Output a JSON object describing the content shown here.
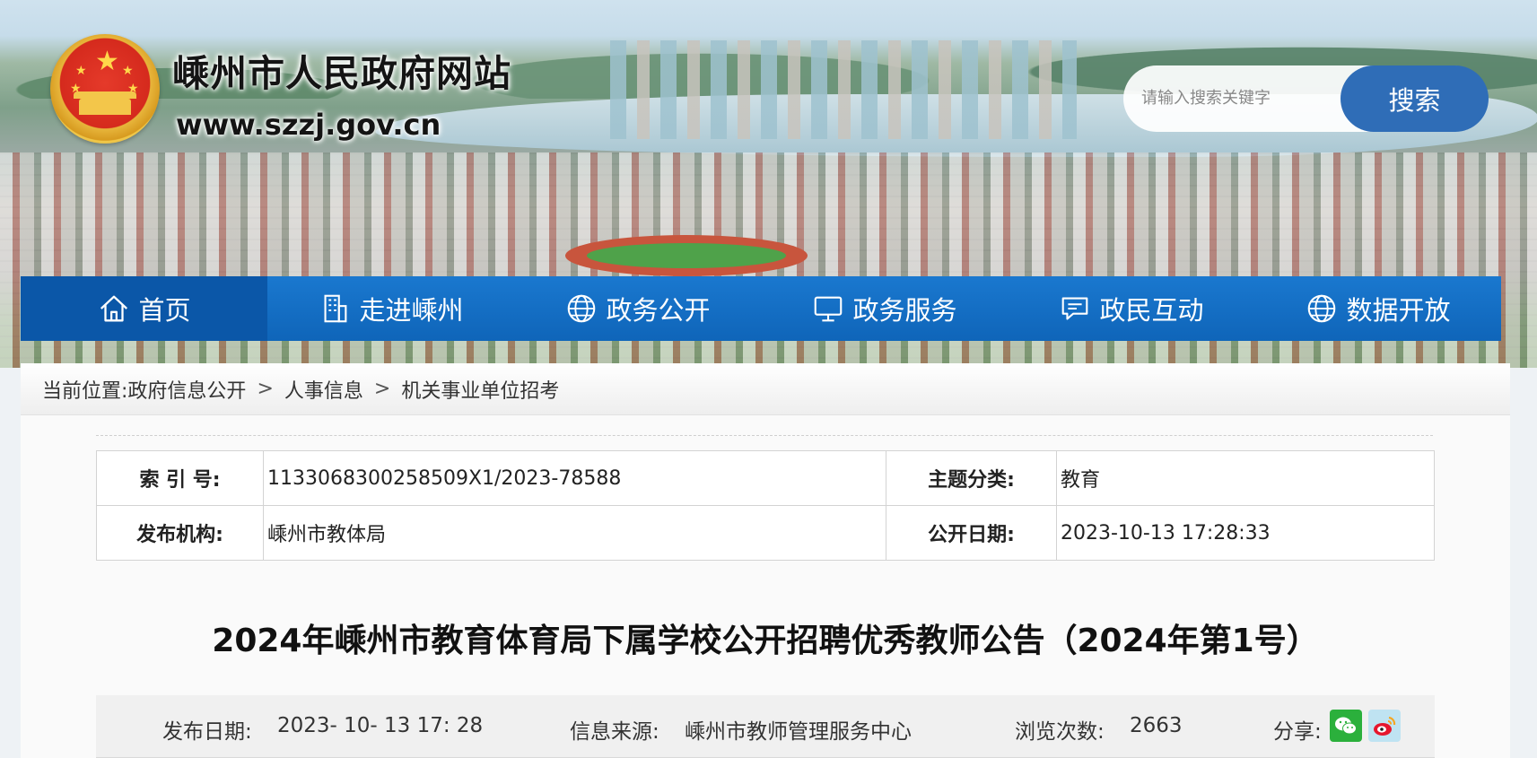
{
  "header": {
    "site_title": "嵊州市人民政府网站",
    "site_url": "www.szzj.gov.cn",
    "emblem_icon": "national-emblem-icon"
  },
  "search": {
    "placeholder": "请输入搜索关键字",
    "button_label": "搜索"
  },
  "nav": {
    "items": [
      {
        "label": "首页",
        "icon": "home-icon"
      },
      {
        "label": "走进嵊州",
        "icon": "building-icon"
      },
      {
        "label": "政务公开",
        "icon": "globe-icon"
      },
      {
        "label": "政务服务",
        "icon": "monitor-icon"
      },
      {
        "label": "政民互动",
        "icon": "chat-icon"
      },
      {
        "label": "数据开放",
        "icon": "globe-icon"
      }
    ],
    "active_color": "#0b57a8",
    "bar_color": "#1570c6"
  },
  "breadcrumb": {
    "prefix": "当前位置:",
    "items": [
      "政府信息公开",
      "人事信息",
      "机关事业单位招考"
    ],
    "separator": ">"
  },
  "meta": {
    "index_label": "索 引 号:",
    "index_value": "1133068300258509X1/2023-78588",
    "topic_label": "主题分类:",
    "topic_value": "教育",
    "publisher_label": "发布机构:",
    "publisher_value": "嵊州市教体局",
    "open_date_label": "公开日期:",
    "open_date_value": "2023-10-13 17:28:33"
  },
  "article": {
    "title": "2024年嵊州市教育体育局下属学校公开招聘优秀教师公告（2024年第1号）",
    "publish_date_label": "发布日期:",
    "publish_date_value": "2023- 10- 13 17: 28",
    "source_label": "信息来源:",
    "source_value": "嵊州市教师管理服务中心",
    "views_label": "浏览次数:",
    "views_value": "2663",
    "share_label": "分享:"
  }
}
